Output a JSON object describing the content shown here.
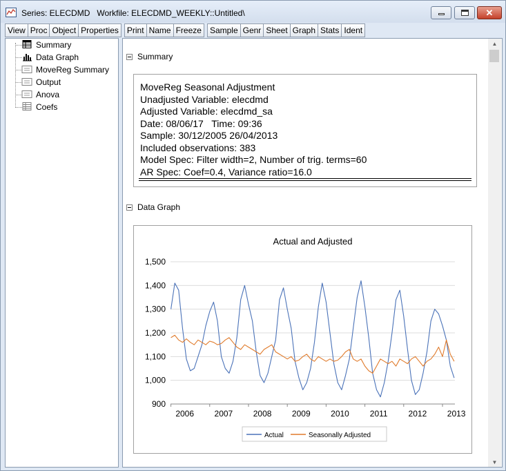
{
  "window": {
    "title": "Series: ELECDMD   Workfile: ELECDMD_WEEKLY::Untitled\\",
    "controls": [
      "minimize",
      "maximize",
      "close"
    ]
  },
  "toolbar": {
    "group1": [
      "View",
      "Proc",
      "Object",
      "Properties"
    ],
    "group2": [
      "Print",
      "Name",
      "Freeze"
    ],
    "group3": [
      "Sample",
      "Genr",
      "Sheet",
      "Graph",
      "Stats",
      "Ident"
    ]
  },
  "tree": {
    "items": [
      {
        "label": "Summary",
        "icon": "table-icon"
      },
      {
        "label": "Data Graph",
        "icon": "bar-chart-icon"
      },
      {
        "label": "MoveReg Summary",
        "icon": "text-doc-icon"
      },
      {
        "label": "Output",
        "icon": "text-doc-icon"
      },
      {
        "label": "Anova",
        "icon": "text-doc-icon"
      },
      {
        "label": "Coefs",
        "icon": "table-icon"
      }
    ]
  },
  "summary": {
    "header": "Summary",
    "lines": [
      "MoveReg Seasonal Adjustment",
      "Unadjusted Variable: elecdmd",
      "Adjusted Variable: elecdmd_sa",
      "Date: 08/06/17   Time: 09:36",
      "Sample: 30/12/2005 26/04/2013",
      "Included observations: 383",
      "Model Spec: Filter width=2, Number of trig. terms=60",
      "AR Spec: Coef=0.4, Variance ratio=16.0"
    ]
  },
  "data_graph": {
    "header": "Data Graph"
  },
  "chart_data": {
    "type": "line",
    "title": "Actual and Adjusted",
    "xlabel": "",
    "ylabel": "",
    "ylim": [
      900,
      1500
    ],
    "yticks": [
      900,
      1000,
      1100,
      1200,
      1300,
      1400,
      1500
    ],
    "ytick_labels": [
      "900",
      "1,000",
      "1,100",
      "1,200",
      "1,300",
      "1,400",
      "1,500"
    ],
    "xlim": [
      2005.99,
      2013.32
    ],
    "xticks": [
      2006,
      2007,
      2008,
      2009,
      2010,
      2011,
      2012,
      2013
    ],
    "xtick_labels": [
      "2006",
      "2007",
      "2008",
      "2009",
      "2010",
      "2011",
      "2012",
      "2013"
    ],
    "grid": true,
    "legend": "bottom",
    "x": [
      2006.0,
      2006.1,
      2006.2,
      2006.3,
      2006.4,
      2006.5,
      2006.6,
      2006.7,
      2006.8,
      2006.9,
      2007.0,
      2007.1,
      2007.2,
      2007.3,
      2007.4,
      2007.5,
      2007.6,
      2007.7,
      2007.8,
      2007.9,
      2008.0,
      2008.1,
      2008.2,
      2008.3,
      2008.4,
      2008.5,
      2008.6,
      2008.7,
      2008.8,
      2008.9,
      2009.0,
      2009.1,
      2009.2,
      2009.3,
      2009.4,
      2009.5,
      2009.6,
      2009.7,
      2009.8,
      2009.9,
      2010.0,
      2010.1,
      2010.2,
      2010.3,
      2010.4,
      2010.5,
      2010.6,
      2010.7,
      2010.8,
      2010.9,
      2011.0,
      2011.1,
      2011.2,
      2011.3,
      2011.4,
      2011.5,
      2011.6,
      2011.7,
      2011.8,
      2011.9,
      2012.0,
      2012.1,
      2012.2,
      2012.3,
      2012.4,
      2012.5,
      2012.6,
      2012.7,
      2012.8,
      2012.9,
      2013.0,
      2013.1,
      2013.2,
      2013.3
    ],
    "series": [
      {
        "name": "Actual",
        "color": "#4a72b8",
        "values": [
          1300,
          1410,
          1380,
          1220,
          1090,
          1040,
          1050,
          1100,
          1150,
          1230,
          1290,
          1330,
          1250,
          1100,
          1050,
          1030,
          1080,
          1180,
          1340,
          1400,
          1320,
          1250,
          1120,
          1020,
          990,
          1030,
          1100,
          1170,
          1340,
          1390,
          1300,
          1220,
          1080,
          1010,
          960,
          990,
          1050,
          1160,
          1310,
          1410,
          1330,
          1200,
          1070,
          990,
          960,
          1020,
          1090,
          1220,
          1350,
          1420,
          1310,
          1180,
          1030,
          960,
          930,
          990,
          1080,
          1200,
          1340,
          1380,
          1270,
          1130,
          1000,
          940,
          960,
          1030,
          1120,
          1250,
          1300,
          1280,
          1230,
          1170,
          1060,
          1010
        ]
      },
      {
        "name": "Seasonally Adjusted",
        "color": "#e07a2a",
        "values": [
          1180,
          1190,
          1170,
          1160,
          1175,
          1160,
          1150,
          1170,
          1160,
          1150,
          1165,
          1160,
          1150,
          1155,
          1170,
          1180,
          1160,
          1140,
          1130,
          1150,
          1140,
          1130,
          1120,
          1110,
          1130,
          1140,
          1150,
          1120,
          1110,
          1100,
          1090,
          1100,
          1080,
          1085,
          1100,
          1110,
          1090,
          1080,
          1100,
          1090,
          1080,
          1090,
          1080,
          1085,
          1100,
          1120,
          1130,
          1090,
          1080,
          1090,
          1060,
          1040,
          1030,
          1060,
          1090,
          1080,
          1070,
          1080,
          1060,
          1090,
          1080,
          1070,
          1090,
          1100,
          1080,
          1060,
          1080,
          1090,
          1110,
          1140,
          1100,
          1170,
          1110,
          1080
        ]
      }
    ]
  }
}
